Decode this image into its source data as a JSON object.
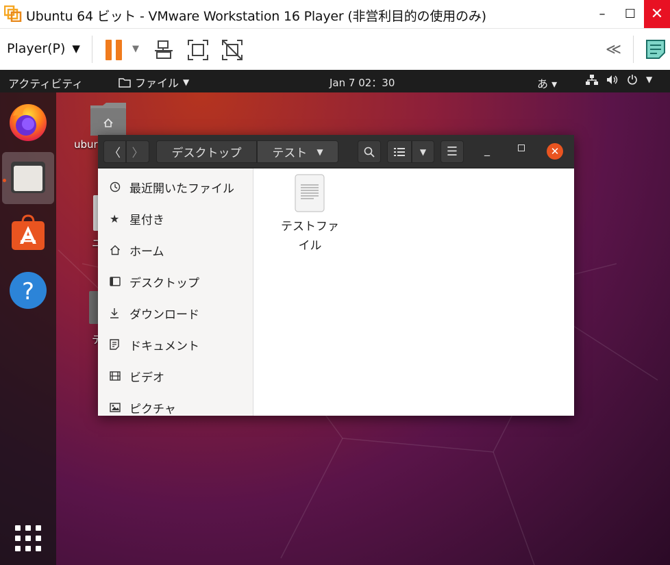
{
  "window": {
    "title": "Ubuntu 64 ビット - VMware Workstation 16 Player (非営利目的の使用のみ)",
    "minimize": "–",
    "maximize": "☐",
    "close": "✕"
  },
  "toolbar": {
    "player_menu": "Player(P)",
    "collapse": "≪",
    "accent": "#f07b1d"
  },
  "ubuntu_topbar": {
    "activities": "アクティビティ",
    "app_menu": "ファイル",
    "clock": "Jan 7  02：30",
    "ime": "あ ▾"
  },
  "desktop": {
    "icons": [
      {
        "label": "ubur"
      },
      {
        "label": "ニ"
      },
      {
        "label": "テ"
      }
    ]
  },
  "nautilus": {
    "breadcrumb": {
      "desktop": "デスクトップ",
      "current": "テスト"
    },
    "sidebar": [
      {
        "label": "最近開いたファイル",
        "icon": "clock-icon"
      },
      {
        "label": "星付き",
        "icon": "star-icon"
      },
      {
        "label": "ホーム",
        "icon": "home-icon"
      },
      {
        "label": "デスクトップ",
        "icon": "desktop-icon"
      },
      {
        "label": "ダウンロード",
        "icon": "download-icon"
      },
      {
        "label": "ドキュメント",
        "icon": "document-icon"
      },
      {
        "label": "ビデオ",
        "icon": "video-icon"
      },
      {
        "label": "ピクチャ",
        "icon": "picture-icon"
      }
    ],
    "files": [
      {
        "label_line1": "テストファ",
        "label_line2": "イル"
      }
    ]
  }
}
